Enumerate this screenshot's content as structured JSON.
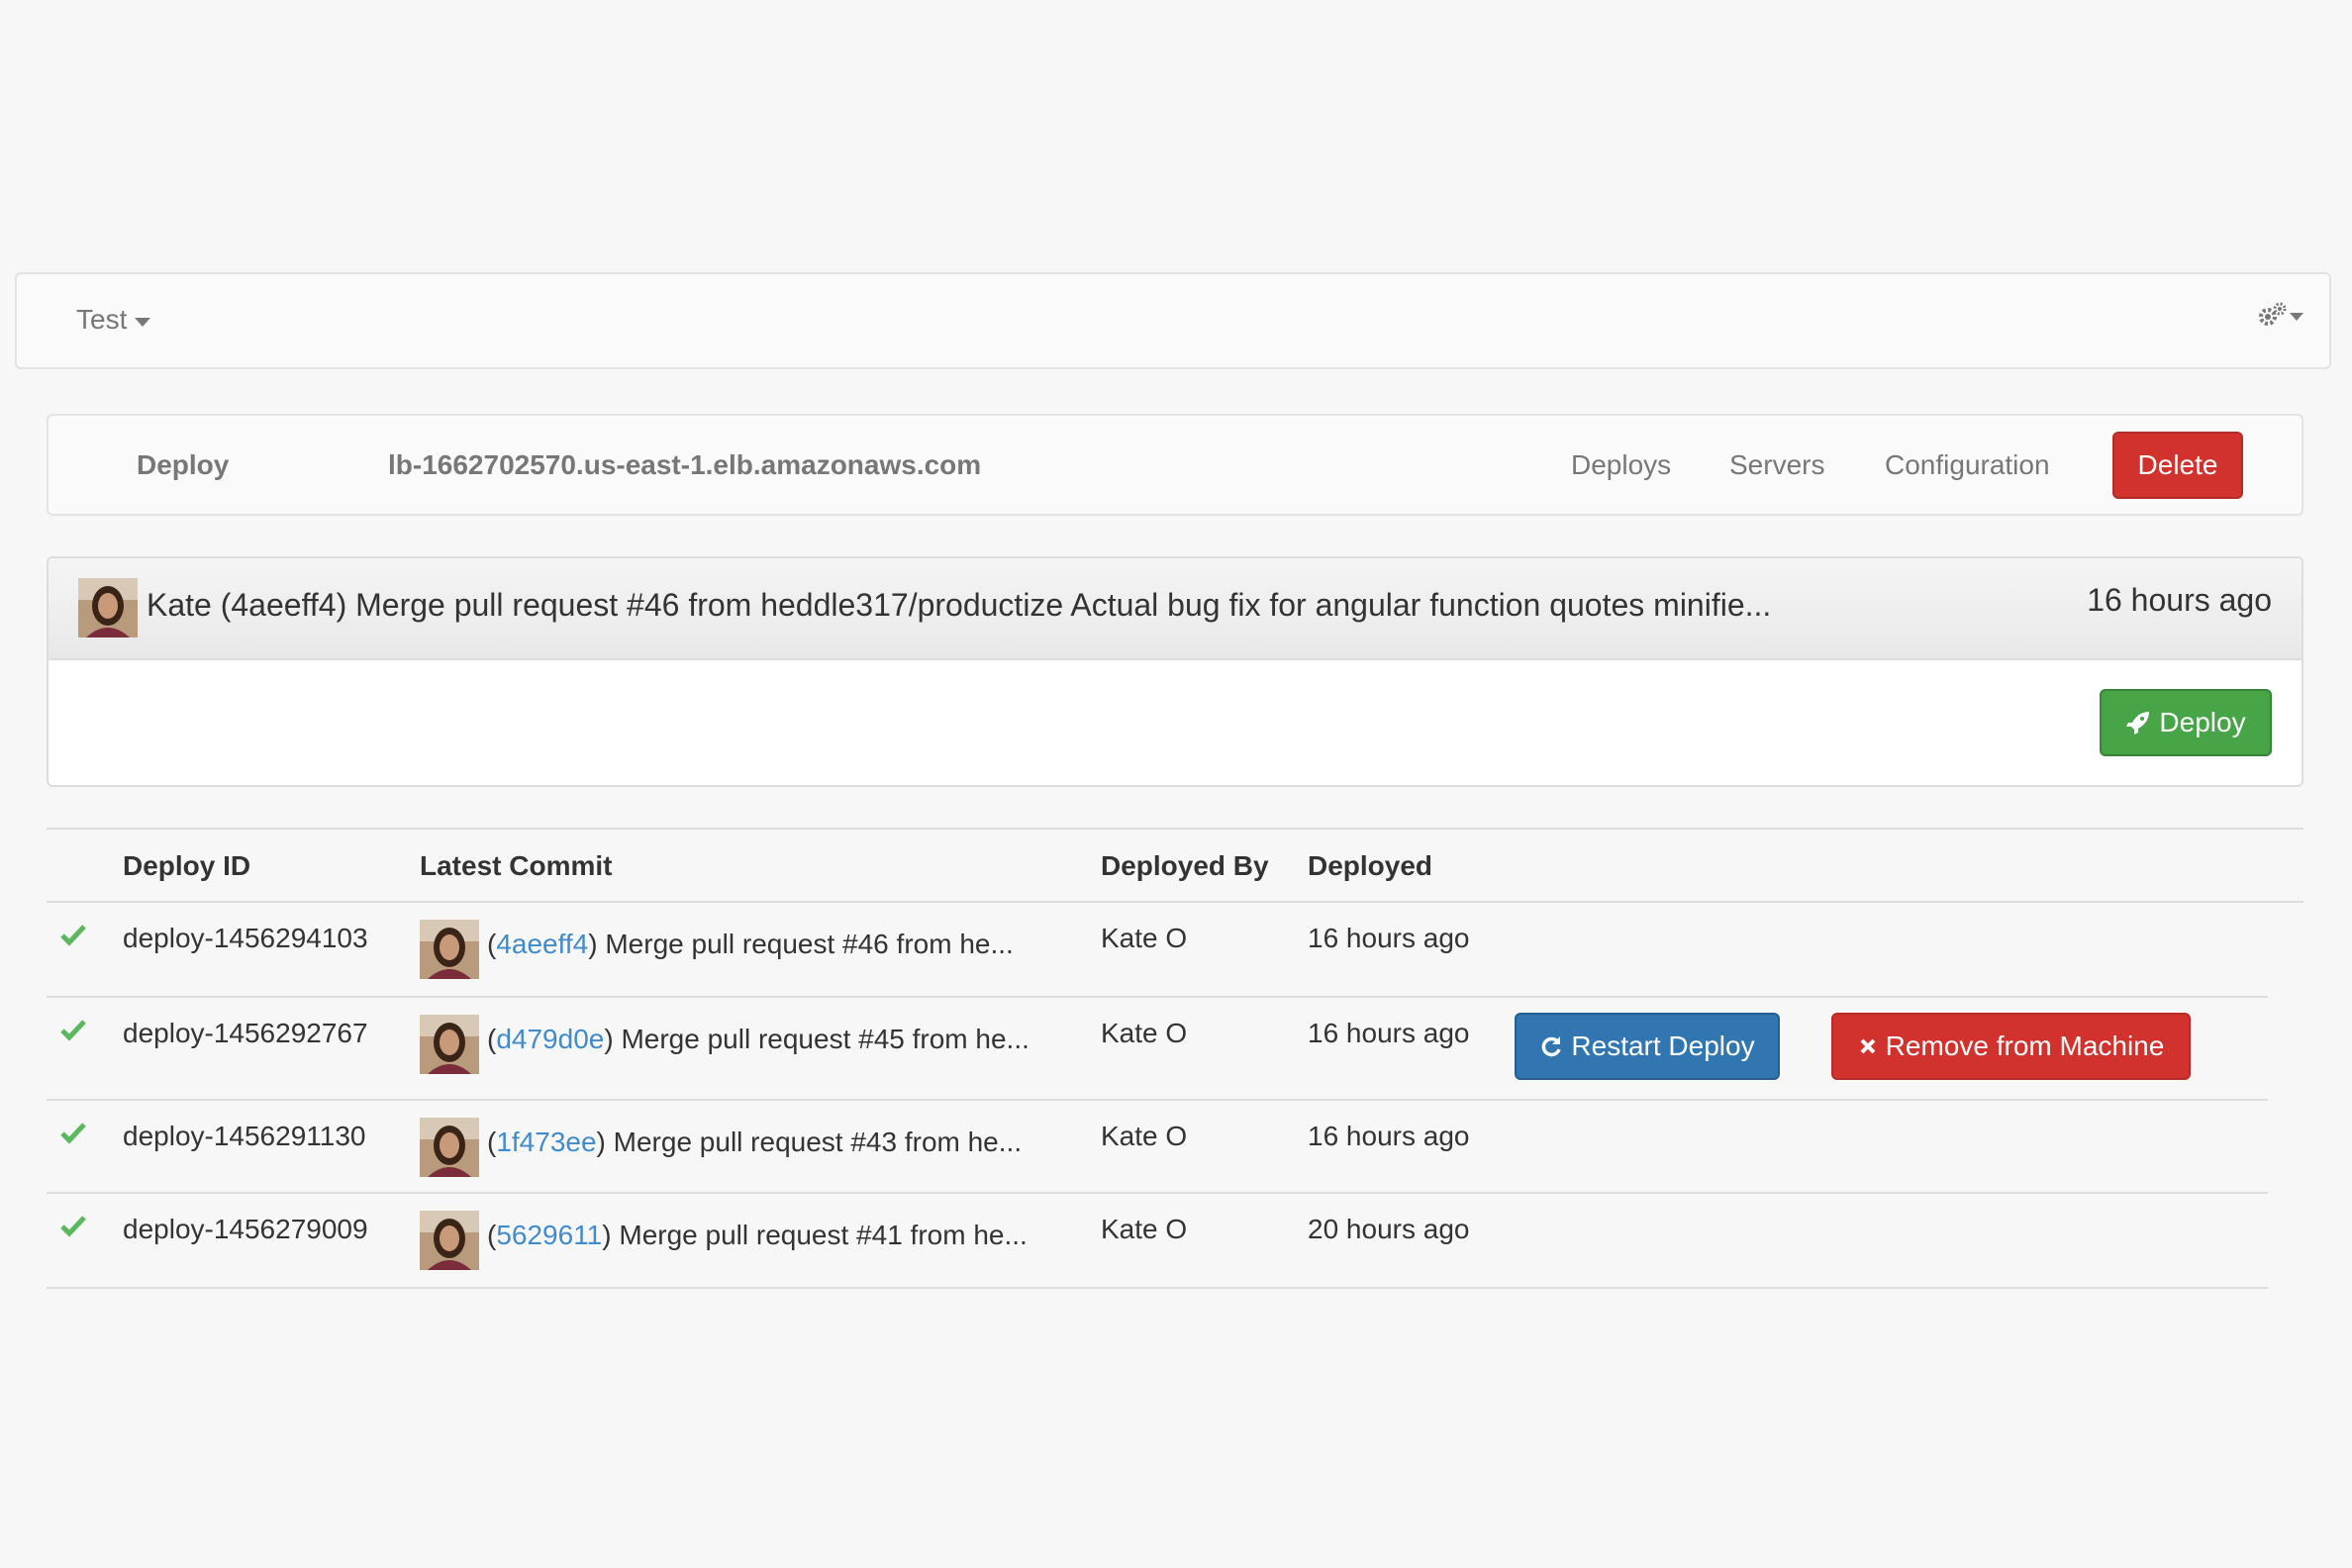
{
  "topnav": {
    "app_name": "Test"
  },
  "subnav": {
    "brand": "Deploy",
    "host": "lb-1662702570.us-east-1.elb.amazonaws.com",
    "links": [
      "Deploys",
      "Servers",
      "Configuration"
    ],
    "delete_label": "Delete"
  },
  "latest": {
    "commit_text": "Kate (4aeeff4) Merge pull request #46 from heddle317/productize Actual bug fix for angular function quotes minifie...",
    "time": "16 hours ago",
    "deploy_label": "Deploy"
  },
  "table": {
    "headers": {
      "id": "Deploy ID",
      "commit": "Latest Commit",
      "by": "Deployed By",
      "deployed": "Deployed"
    },
    "rows": [
      {
        "id": "deploy-1456294103",
        "sha": "4aeeff4",
        "msg": "Merge pull request #46 from he...",
        "by": "Kate O",
        "deployed": "16 hours ago"
      },
      {
        "id": "deploy-1456292767",
        "sha": "d479d0e",
        "msg": "Merge pull request #45 from he...",
        "by": "Kate O",
        "deployed": "16 hours ago"
      },
      {
        "id": "deploy-1456291130",
        "sha": "1f473ee",
        "msg": "Merge pull request #43 from he...",
        "by": "Kate O",
        "deployed": "16 hours ago"
      },
      {
        "id": "deploy-1456279009",
        "sha": "5629611",
        "msg": "Merge pull request #41 from he...",
        "by": "Kate O",
        "deployed": "20 hours ago"
      }
    ],
    "restart_label": "Restart Deploy",
    "remove_label": "Remove from Machine"
  },
  "colors": {
    "success": "#5cb85c",
    "primary": "#3276b1",
    "danger": "#d2322d",
    "link": "#428bca"
  }
}
